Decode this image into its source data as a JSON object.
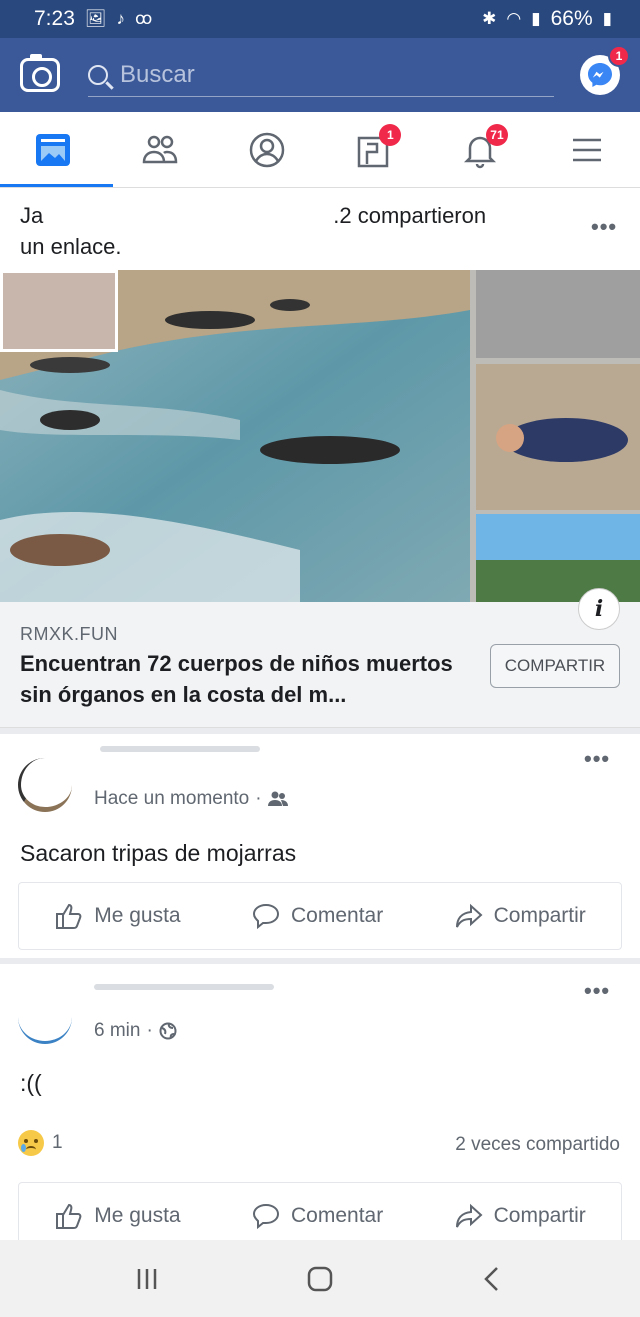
{
  "status_bar": {
    "time": "7:23",
    "left_icons": [
      "image-icon",
      "tiktok-icon",
      "voicemail-icon"
    ],
    "right_icons": [
      "bluetooth-icon",
      "wifi-icon",
      "signal-icon"
    ],
    "battery": "66%"
  },
  "top_bar": {
    "search_placeholder": "Buscar",
    "messenger_badge": "1"
  },
  "nav_tabs": [
    {
      "name": "news-feed",
      "icon": "news-feed-icon",
      "badge": null,
      "active": true
    },
    {
      "name": "friends",
      "icon": "friends-icon",
      "badge": null,
      "active": false
    },
    {
      "name": "profile",
      "icon": "profile-icon",
      "badge": null,
      "active": false
    },
    {
      "name": "pages",
      "icon": "pages-icon",
      "badge": "1",
      "active": false
    },
    {
      "name": "notifications",
      "icon": "bell-icon",
      "badge": "71",
      "active": false
    },
    {
      "name": "menu",
      "icon": "menu-icon",
      "badge": null,
      "active": false
    }
  ],
  "shared_post": {
    "header_start": "Ja",
    "header_mid": ".2 compartieron",
    "header_end": "un enlace.",
    "more": "•••",
    "link": {
      "domain": "RMXK.FUN",
      "title": "Encuentran 72 cuerpos de niños muertos sin órganos en la costa del m...",
      "share_button": "COMPARTIR",
      "info_button": "i"
    }
  },
  "comment_post_1": {
    "timestamp": "Hace un momento",
    "audience_icon": "friends-audience-icon",
    "text": "Sacaron tripas de mojarras",
    "more": "•••"
  },
  "comment_post_2": {
    "timestamp": "6 min",
    "audience_icon": "globe-icon",
    "text": ":((",
    "more": "•••",
    "reaction_count": "1",
    "share_count": "2 veces compartido"
  },
  "actions": {
    "like": "Me gusta",
    "comment": "Comentar",
    "share": "Compartir"
  },
  "system_nav": [
    "recents-icon",
    "home-icon",
    "back-icon"
  ],
  "colors": {
    "facebook_blue": "#3b5998",
    "status_bar": "#29487d",
    "badge_red": "#f02849",
    "active_tab": "#1877f2"
  }
}
